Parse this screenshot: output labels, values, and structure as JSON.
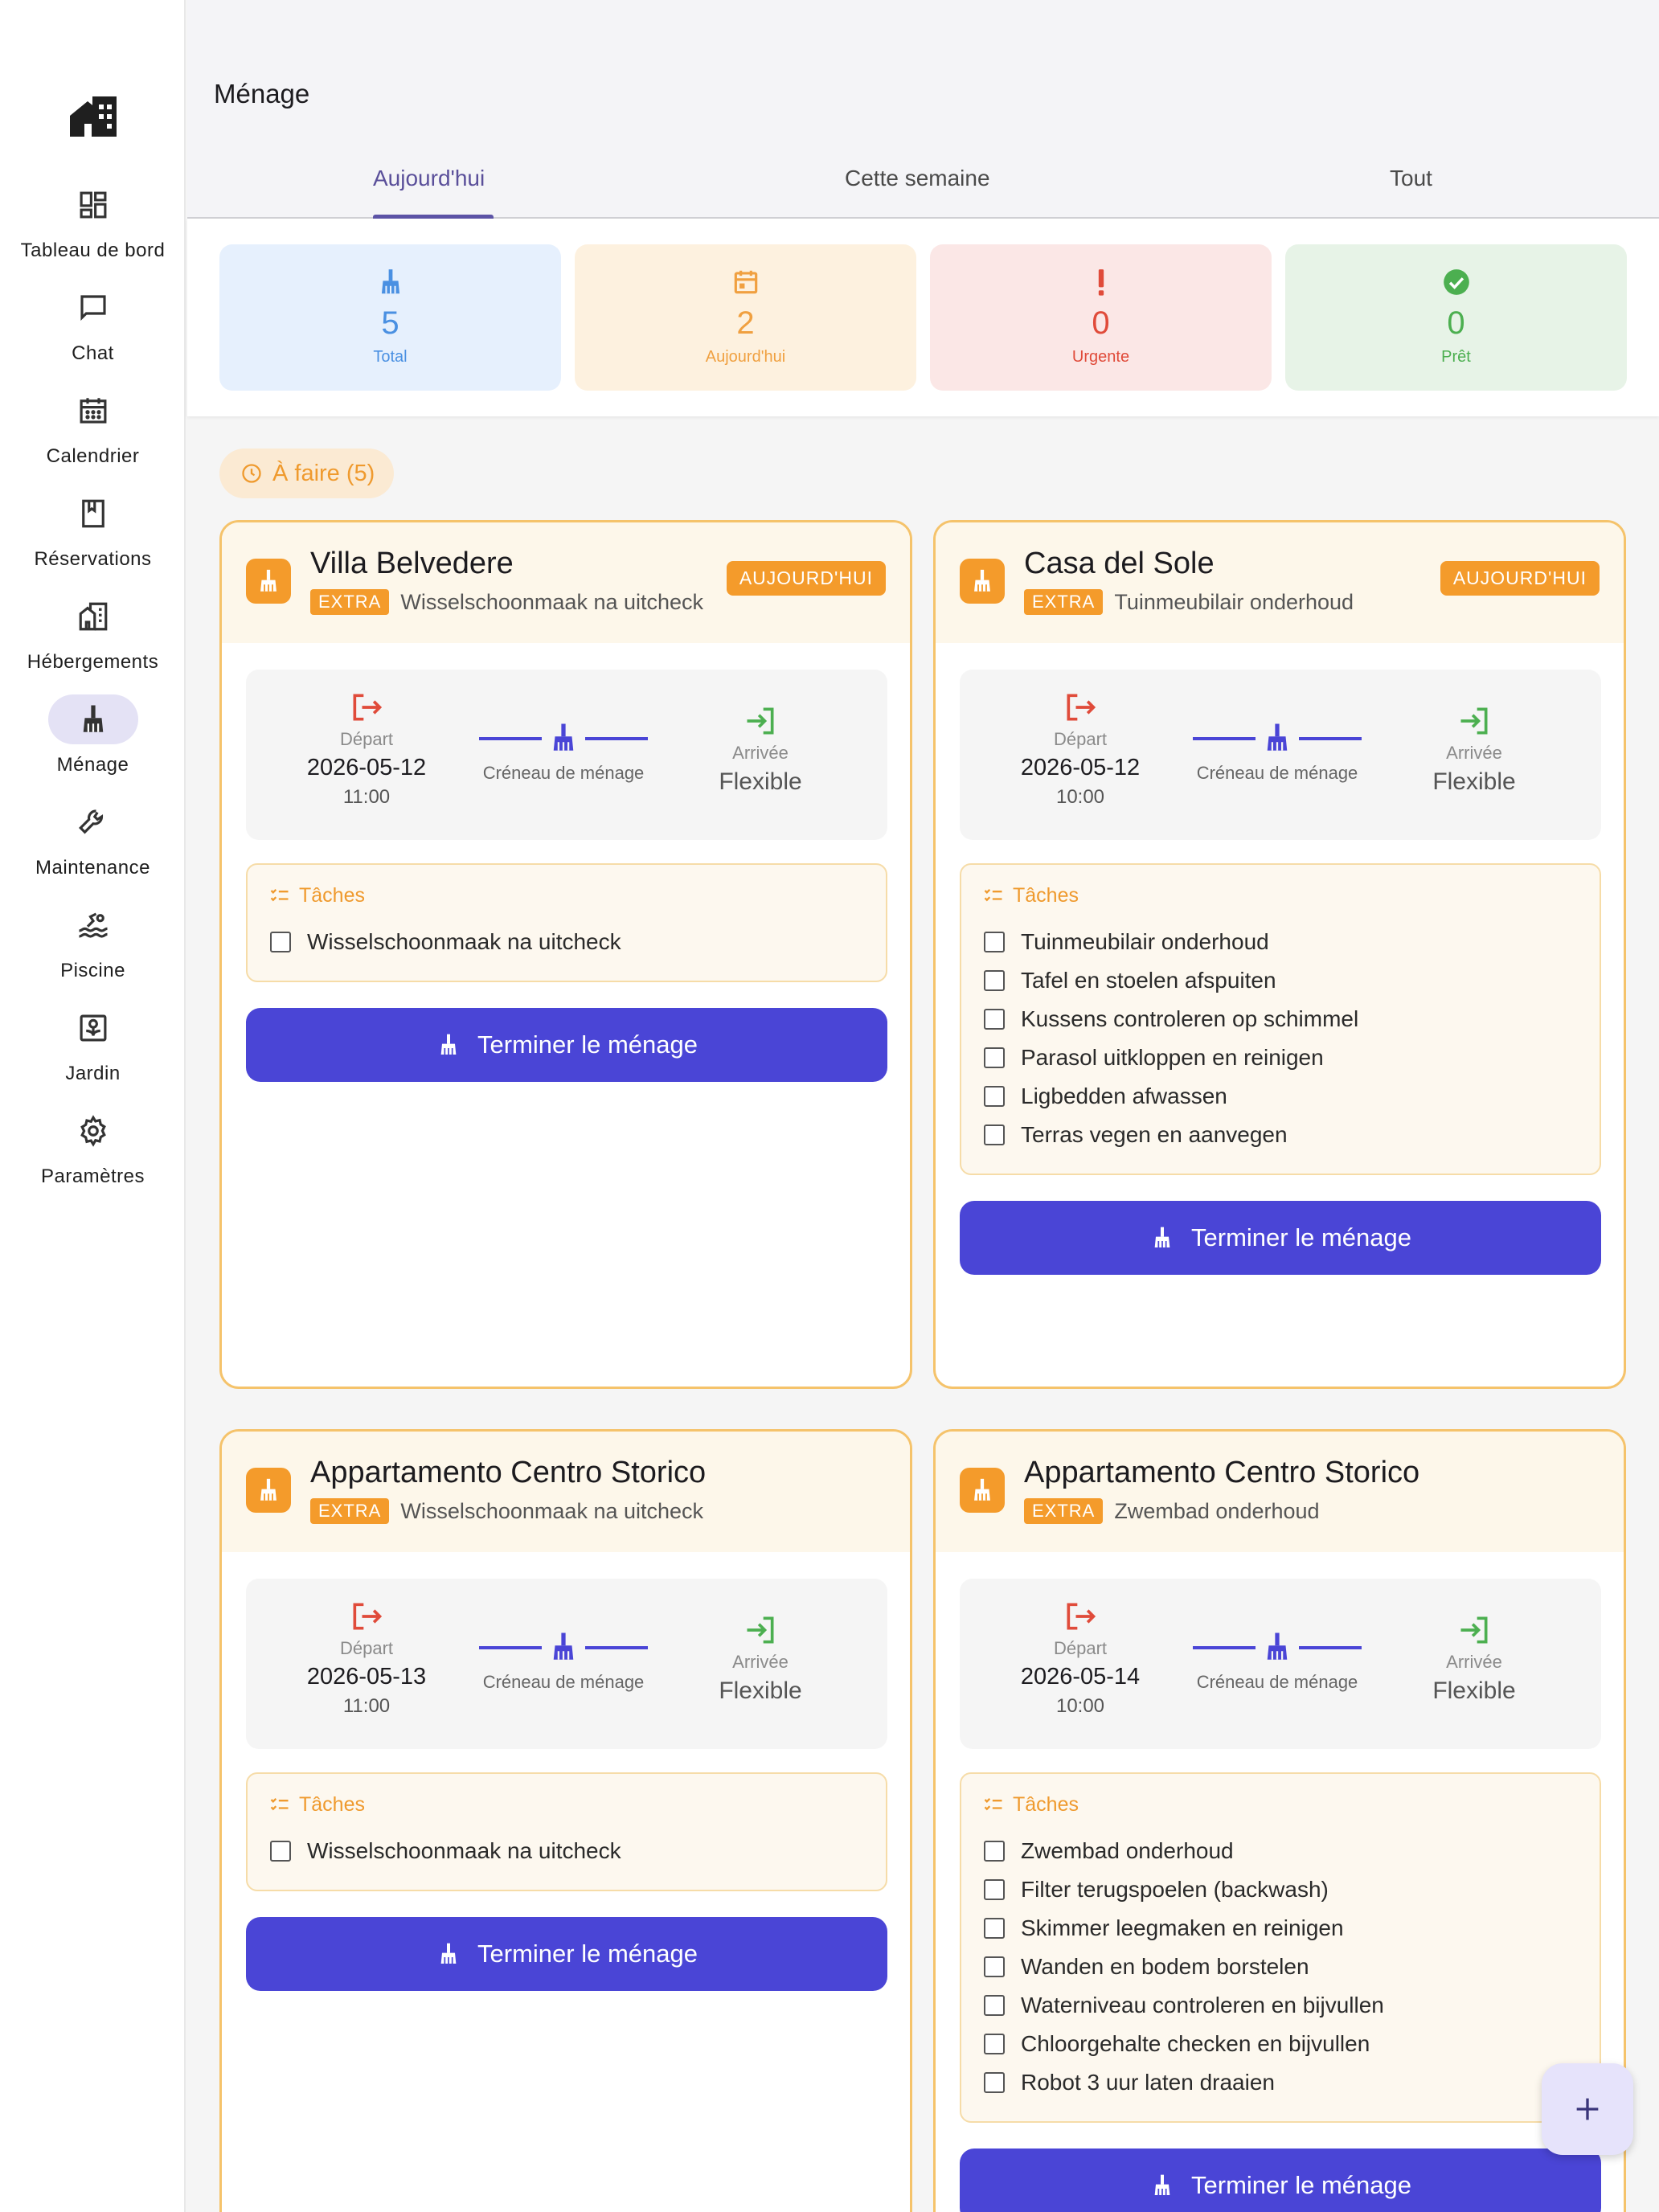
{
  "nav": {
    "items": [
      {
        "label": "Tableau de bord",
        "icon": "dashboard-icon"
      },
      {
        "label": "Chat",
        "icon": "chat-icon"
      },
      {
        "label": "Calendrier",
        "icon": "calendar-icon"
      },
      {
        "label": "Réservations",
        "icon": "book-icon"
      },
      {
        "label": "Hébergements",
        "icon": "buildings-icon"
      },
      {
        "label": "Ménage",
        "icon": "broom-icon",
        "active": true
      },
      {
        "label": "Maintenance",
        "icon": "wrench-icon"
      },
      {
        "label": "Piscine",
        "icon": "pool-icon"
      },
      {
        "label": "Jardin",
        "icon": "garden-icon"
      },
      {
        "label": "Paramètres",
        "icon": "gear-icon"
      }
    ]
  },
  "header": {
    "title": "Ménage",
    "tabs": [
      {
        "label": "Aujourd'hui",
        "active": true
      },
      {
        "label": "Cette semaine"
      },
      {
        "label": "Tout"
      }
    ]
  },
  "stats": [
    {
      "value": "5",
      "label": "Total",
      "color": "#4a90e2",
      "bg": "#e6f0fd"
    },
    {
      "value": "2",
      "label": "Aujourd'hui",
      "color": "#f0a040",
      "bg": "#fdf1df"
    },
    {
      "value": "0",
      "label": "Urgente",
      "color": "#e04b3a",
      "bg": "#fbe7e6"
    },
    {
      "value": "0",
      "label": "Prêt",
      "color": "#4caf50",
      "bg": "#e7f3e7"
    }
  ],
  "section": {
    "label": "À faire (5)"
  },
  "labels": {
    "extra": "EXTRA",
    "today": "AUJOURD'HUI",
    "departure": "Départ",
    "arrival": "Arrivée",
    "slot": "Créneau de ménage",
    "flexible": "Flexible",
    "tasks": "Tâches",
    "finish": "Terminer le ménage"
  },
  "cards": [
    {
      "title": "Villa Belvedere",
      "subtitle": "Wisselschoonmaak na uitcheck",
      "today": true,
      "date": "2026-05-12",
      "time": "11:00",
      "tasks": [
        "Wisselschoonmaak na uitcheck"
      ]
    },
    {
      "title": "Casa del Sole",
      "subtitle": "Tuinmeubilair onderhoud",
      "today": true,
      "date": "2026-05-12",
      "time": "10:00",
      "tasks": [
        "Tuinmeubilair onderhoud",
        "Tafel en stoelen afspuiten",
        "Kussens controleren op schimmel",
        "Parasol uitkloppen en reinigen",
        "Ligbedden afwassen",
        "Terras vegen en aanvegen"
      ]
    },
    {
      "title": "Appartamento Centro Storico",
      "subtitle": "Wisselschoonmaak na uitcheck",
      "today": false,
      "date": "2026-05-13",
      "time": "11:00",
      "tasks": [
        "Wisselschoonmaak na uitcheck"
      ]
    },
    {
      "title": "Appartamento Centro Storico",
      "subtitle": "Zwembad onderhoud",
      "today": false,
      "date": "2026-05-14",
      "time": "10:00",
      "tasks": [
        "Zwembad onderhoud",
        "Filter terugspoelen (backwash)",
        "Skimmer leegmaken en reinigen",
        "Wanden en bodem borstelen",
        "Waterniveau controleren en bijvullen",
        "Chloorgehalte checken en bijvullen",
        "Robot 3 uur laten draaien"
      ]
    }
  ],
  "fab": {
    "icon": "plus-icon"
  }
}
